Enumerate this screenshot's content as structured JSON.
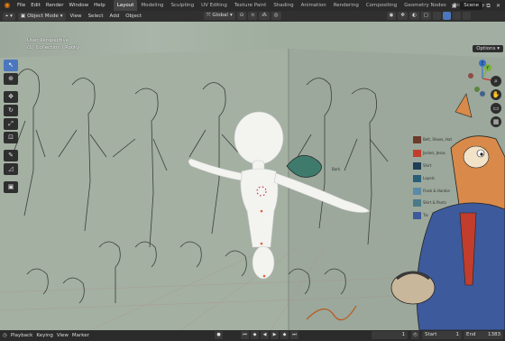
{
  "menu": {
    "items": [
      "File",
      "Edit",
      "Render",
      "Window",
      "Help"
    ],
    "workspaces": [
      "Layout",
      "Modeling",
      "Sculpting",
      "UV Editing",
      "Texture Paint",
      "Shading",
      "Animation",
      "Rendering",
      "Compositing",
      "Geometry Nodes",
      "Scripting"
    ],
    "active_workspace": "Layout",
    "scene": "Scene"
  },
  "header": {
    "mode": "Object Mode",
    "menus": [
      "View",
      "Select",
      "Add",
      "Object"
    ],
    "orientation": "Global"
  },
  "viewport": {
    "perspective": "User Perspective",
    "collection": "(1) Collection | Rocky",
    "options_label": "Options"
  },
  "gizmo": {
    "x": "X",
    "y": "Y",
    "z": "Z"
  },
  "sheet": {
    "labels": [
      "Belt, Shoes, Hat",
      "Jacket, Jesas",
      "Shirt",
      "Lapels",
      "Flask & Hankie",
      "Shirt & Pants",
      "Tie"
    ],
    "small_label": "Bark"
  },
  "timeline": {
    "items": [
      "Playback",
      "Keying",
      "View",
      "Marker"
    ],
    "frame_current": "1",
    "start_label": "Start",
    "start_value": "1",
    "end_label": "End",
    "end_value": "1383"
  },
  "colors": {
    "accent": "#4b77be",
    "blender_orange": "#e87d0d",
    "swatches": [
      "#6b3a2a",
      "#c23d2c",
      "#1f3e58",
      "#2a5f7a",
      "#5b8aa8",
      "#4a7a8a",
      "#3d5a9c"
    ]
  }
}
